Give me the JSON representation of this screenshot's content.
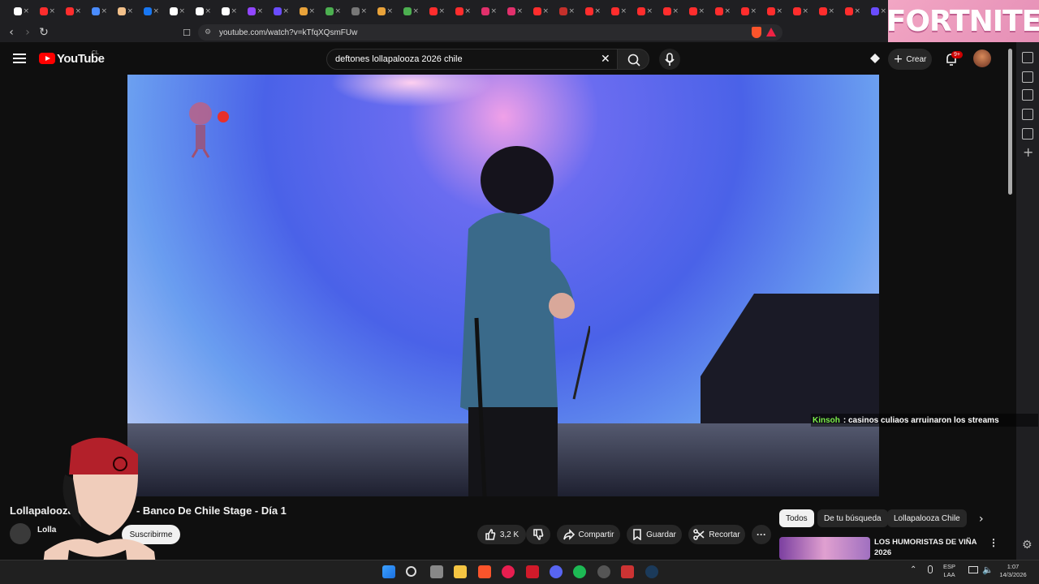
{
  "browser": {
    "url": "youtube.com/watch?v=kTfqXQsmFUw",
    "tab_colors": [
      "#ffffff",
      "#ff2d2d",
      "#ff2d2d",
      "#4a8cff",
      "#f2c08a",
      "#1877f2",
      "#ffffff",
      "#ffffff",
      "#ffffff",
      "#9146ff",
      "#6a4cff",
      "#e8a23a",
      "#4caf50",
      "#777777",
      "#e8a23a",
      "#4caf50",
      "#ff2d2d",
      "#ff2d2d",
      "#e1306c",
      "#e1306c",
      "#ff2d2d",
      "#c4302b",
      "#ff2d2d",
      "#ff2d2d",
      "#ff2d2d",
      "#ff2d2d",
      "#ff2d2d",
      "#ff2d2d",
      "#ff2d2d",
      "#ff2d2d",
      "#ff2d2d",
      "#ff2d2d",
      "#ff2d2d",
      "#6a4cff"
    ],
    "ad_banner": "FORTNITE"
  },
  "header": {
    "logo": "YouTube",
    "country": "CL",
    "search_query": "deftones lollapalooza 2026 chile",
    "create_label": "Crear",
    "notif_badge": "9+"
  },
  "overlay_chat": {
    "user": "Kinsoh",
    "message": ": casinos culiaos arruinaron los streams"
  },
  "video": {
    "title": "Lollapalooza … - Banco De Chile Stage - Día 1",
    "title_left": "Lollapalooza",
    "title_right": "- Banco De Chile Stage - Día 1",
    "channel": "Lolla",
    "subscribe_label": "Suscribirme",
    "likes": "3,2 K",
    "share_label": "Compartir",
    "save_label": "Guardar",
    "clip_label": "Recortar"
  },
  "chips": [
    "Todos",
    "De tu búsqueda",
    "Lollapalooza Chile"
  ],
  "recommended": {
    "title": "LOS HUMORISTAS DE VIÑA 2026"
  },
  "taskbar": {
    "lang_top": "ESP",
    "lang_bottom": "LAA",
    "time": "1:07",
    "date": "14/3/2026"
  }
}
